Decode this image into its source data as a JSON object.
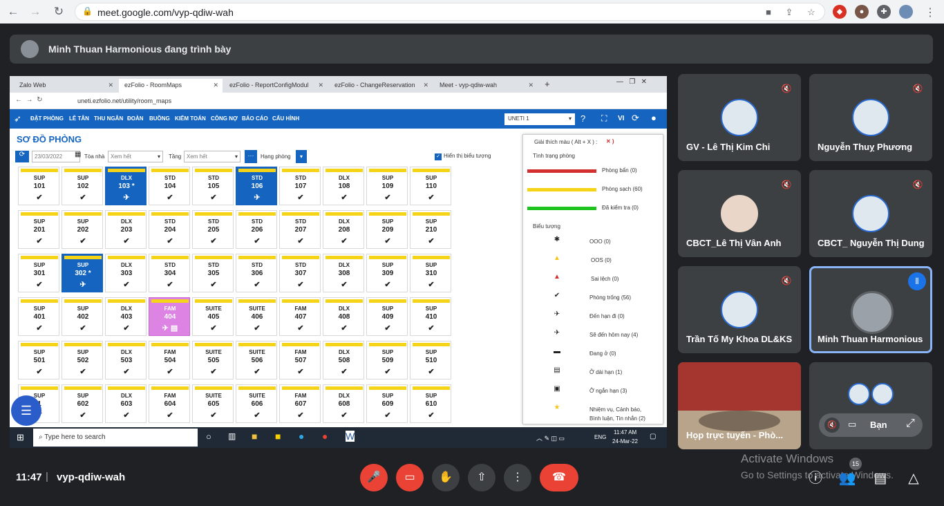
{
  "browser": {
    "url": "meet.google.com/vyp-qdiw-wah",
    "back": "←",
    "forward": "→",
    "reload": "↻"
  },
  "presenter": {
    "text": "Minh Thuan Harmonious đang trình bày"
  },
  "shared": {
    "tabs": [
      "Zalo Web",
      "ezFolio - RoomMaps",
      "ezFolio - ReportConfigModul",
      "ezFolio - ChangeReservation",
      "Meet - vyp-qdiw-wah"
    ],
    "url": "uneti.ezfolio.net/utility/room_maps",
    "nav": [
      "ĐẶT PHÒNG",
      "LỄ TÂN",
      "THU NGÂN",
      "ĐOÀN",
      "BUỒNG",
      "KIỂM TOÁN",
      "CÔNG NỢ",
      "BÁO CÁO",
      "CẤU HÌNH"
    ],
    "hotel_select": "UNETI 1",
    "lang": "VI",
    "page_title": "SƠ ĐỒ PHÒNG",
    "filters": {
      "date": "23/03/2022",
      "building_label": "Tòa nhà",
      "building_value": "Xem hết",
      "floor_label": "Tầng",
      "floor_value": "Xem hết",
      "room_class_label": "Hạng phòng",
      "show_icons_label": "Hiển thị biểu tượng"
    },
    "rooms": [
      [
        [
          "SUP",
          "101"
        ],
        [
          "SUP",
          "102"
        ],
        [
          "DLX",
          "103 *"
        ],
        [
          "STD",
          "104"
        ],
        [
          "STD",
          "105"
        ],
        [
          "STD",
          "106"
        ],
        [
          "STD",
          "107"
        ],
        [
          "DLX",
          "108"
        ],
        [
          "SUP",
          "109"
        ],
        [
          "SUP",
          "110"
        ]
      ],
      [
        [
          "SUP",
          "201"
        ],
        [
          "SUP",
          "202"
        ],
        [
          "DLX",
          "203"
        ],
        [
          "STD",
          "204"
        ],
        [
          "STD",
          "205"
        ],
        [
          "STD",
          "206"
        ],
        [
          "STD",
          "207"
        ],
        [
          "DLX",
          "208"
        ],
        [
          "SUP",
          "209"
        ],
        [
          "SUP",
          "210"
        ]
      ],
      [
        [
          "SUP",
          "301"
        ],
        [
          "SUP",
          "302 *"
        ],
        [
          "DLX",
          "303"
        ],
        [
          "STD",
          "304"
        ],
        [
          "STD",
          "305"
        ],
        [
          "STD",
          "306"
        ],
        [
          "STD",
          "307"
        ],
        [
          "DLX",
          "308"
        ],
        [
          "SUP",
          "309"
        ],
        [
          "SUP",
          "310"
        ]
      ],
      [
        [
          "SUP",
          "401"
        ],
        [
          "SUP",
          "402"
        ],
        [
          "DLX",
          "403"
        ],
        [
          "FAM",
          "404"
        ],
        [
          "SUITE",
          "405"
        ],
        [
          "SUITE",
          "406"
        ],
        [
          "FAM",
          "407"
        ],
        [
          "DLX",
          "408"
        ],
        [
          "SUP",
          "409"
        ],
        [
          "SUP",
          "410"
        ]
      ],
      [
        [
          "SUP",
          "501"
        ],
        [
          "SUP",
          "502"
        ],
        [
          "DLX",
          "503"
        ],
        [
          "FAM",
          "504"
        ],
        [
          "SUITE",
          "505"
        ],
        [
          "SUITE",
          "506"
        ],
        [
          "FAM",
          "507"
        ],
        [
          "DLX",
          "508"
        ],
        [
          "SUP",
          "509"
        ],
        [
          "SUP",
          "510"
        ]
      ],
      [
        [
          "SUP",
          "1"
        ],
        [
          "SUP",
          "602"
        ],
        [
          "DLX",
          "603"
        ],
        [
          "FAM",
          "604"
        ],
        [
          "SUITE",
          "605"
        ],
        [
          "SUITE",
          "606"
        ],
        [
          "FAM",
          "607"
        ],
        [
          "DLX",
          "608"
        ],
        [
          "SUP",
          "609"
        ],
        [
          "SUP",
          "610"
        ]
      ]
    ],
    "legend": {
      "title": "Giải thích màu ( Alt + X ) :",
      "status_title": "Tình trạng phòng",
      "dirty": "Phòng bẩn (0)",
      "clean": "Phòng sạch (60)",
      "inspected": "Đã kiểm tra (0)",
      "icons_title": "Biểu tượng",
      "items": [
        "OOO (0)",
        "OOS (0)",
        "Sai lệch (0)",
        "Phòng trống (56)",
        "Đến hạn đi (0)",
        "Sẽ đến hôm nay (4)",
        "Đang ở (0)",
        "Ở dài hạn (1)",
        "Ở ngắn hạn (3)",
        "Nhiệm vụ, Cảnh báo,",
        "Bình luận, Tin nhắn (2)"
      ]
    },
    "taskbar": {
      "search": "Type here to search",
      "time": "11:47 AM",
      "date": "24-Mar-22",
      "lang": "ENG"
    }
  },
  "participants": [
    {
      "name": "GV - Lê Thị Kim Chi"
    },
    {
      "name": "Nguyễn Thuỵ Phương"
    },
    {
      "name": "CBCT_Lê Thị Vân Anh"
    },
    {
      "name": "CBCT_ Nguyễn Thị Dung"
    },
    {
      "name": "Trần Tố My Khoa DL&KS"
    },
    {
      "name": "Minh Thuan Harmonious"
    },
    {
      "name": "Họp trực tuyến - Phò..."
    },
    {
      "name": "Bạn"
    }
  ],
  "bottom": {
    "time": "11:47",
    "separator": "|",
    "code": "vyp-qdiw-wah",
    "badge": "15",
    "watermark1": "Activate Windows",
    "watermark2": "Go to Settings to activate Windows."
  },
  "colors": {
    "accent": "#1565c0",
    "danger": "#ea4335",
    "clean": "#f5d418",
    "inspected": "#1ec31e",
    "dirty": "#d32f2f"
  }
}
